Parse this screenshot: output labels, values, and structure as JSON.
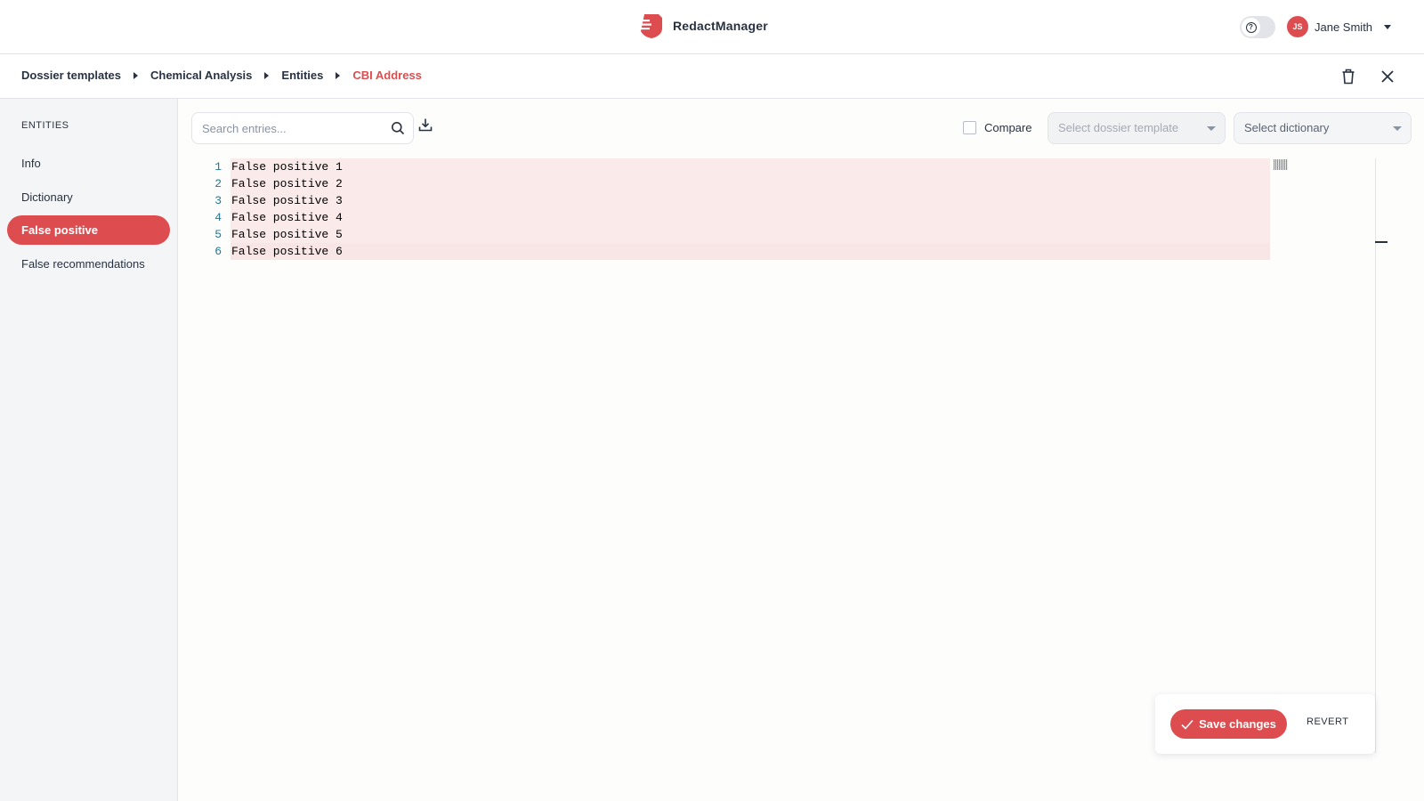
{
  "app": {
    "name": "RedactManager"
  },
  "header": {
    "help_icon": "question-circle-icon",
    "user": {
      "initials": "JS",
      "name": "Jane Smith"
    }
  },
  "breadcrumb": [
    {
      "label": "Dossier templates"
    },
    {
      "label": "Chemical Analysis"
    },
    {
      "label": "Entities"
    },
    {
      "label": "CBI Address",
      "active": true
    }
  ],
  "sidebar": {
    "heading": "ENTITIES",
    "items": [
      {
        "label": "Info"
      },
      {
        "label": "Dictionary"
      },
      {
        "label": "False positive",
        "active": true
      },
      {
        "label": "False recommendations"
      }
    ]
  },
  "toolbar": {
    "search_placeholder": "Search entries...",
    "compare_label": "Compare",
    "compare_checked": false,
    "template_select_placeholder": "Select dossier template",
    "dictionary_select_placeholder": "Select dictionary"
  },
  "editor": {
    "lines": [
      {
        "num": "1",
        "text": "False positive 1"
      },
      {
        "num": "2",
        "text": "False positive 2"
      },
      {
        "num": "3",
        "text": "False positive 3"
      },
      {
        "num": "4",
        "text": "False positive 4"
      },
      {
        "num": "5",
        "text": "False positive 5"
      },
      {
        "num": "6",
        "text": "False positive 6"
      }
    ]
  },
  "actions": {
    "save_label": "Save changes",
    "revert_label": "REVERT"
  },
  "colors": {
    "accent": "#dd4d50",
    "text": "#283241",
    "line_highlight": "#fbeaea"
  }
}
